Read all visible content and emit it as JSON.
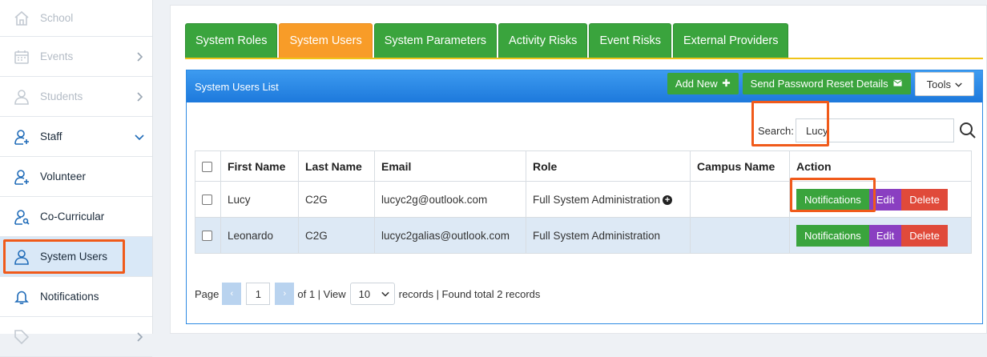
{
  "sidebar": {
    "items": [
      {
        "label": "School",
        "icon": "home-icon"
      },
      {
        "label": "Events",
        "icon": "calendar-icon"
      },
      {
        "label": "Students",
        "icon": "user-icon"
      },
      {
        "label": "Staff",
        "icon": "user-plus-icon"
      },
      {
        "label": "Volunteer",
        "icon": "user-plus-icon"
      },
      {
        "label": "Co-Curricular",
        "icon": "user-search-icon"
      },
      {
        "label": "System Users",
        "icon": "user-icon"
      },
      {
        "label": "Notifications",
        "icon": "bell-icon"
      }
    ]
  },
  "tabs": [
    "System Roles",
    "System Users",
    "System Parameters",
    "Activity Risks",
    "Event Risks",
    "External Providers"
  ],
  "active_tab": "System Users",
  "list": {
    "title": "System Users List",
    "add_new": "Add New",
    "send_reset": "Send Password Reset Details",
    "tools": "Tools"
  },
  "search": {
    "label": "Search:",
    "value": "Lucy"
  },
  "table": {
    "headers": [
      "First Name",
      "Last Name",
      "Email",
      "Role",
      "Campus Name",
      "Action"
    ],
    "rows": [
      {
        "first": "Lucy",
        "last": "C2G",
        "email": "lucyc2g@outlook.com",
        "role": "Full System Administration",
        "campus": ""
      },
      {
        "first": "Leonardo",
        "last": "C2G",
        "email": "lucyc2galias@outlook.com",
        "role": "Full System Administration",
        "campus": ""
      }
    ],
    "actions": {
      "notifications": "Notifications",
      "edit": "Edit",
      "delete": "Delete"
    }
  },
  "pager": {
    "page_label": "Page",
    "page": "1",
    "of_text": "of 1 | View",
    "view": "10",
    "records_text": "records | Found total 2 records"
  },
  "colors": {
    "tab_green": "#3aa43d",
    "tab_active": "#f89c28",
    "header_blue": "#2d8ae3",
    "highlight": "#f05a1a",
    "edit_purple": "#8a3fc1",
    "delete_red": "#e04a3a"
  }
}
